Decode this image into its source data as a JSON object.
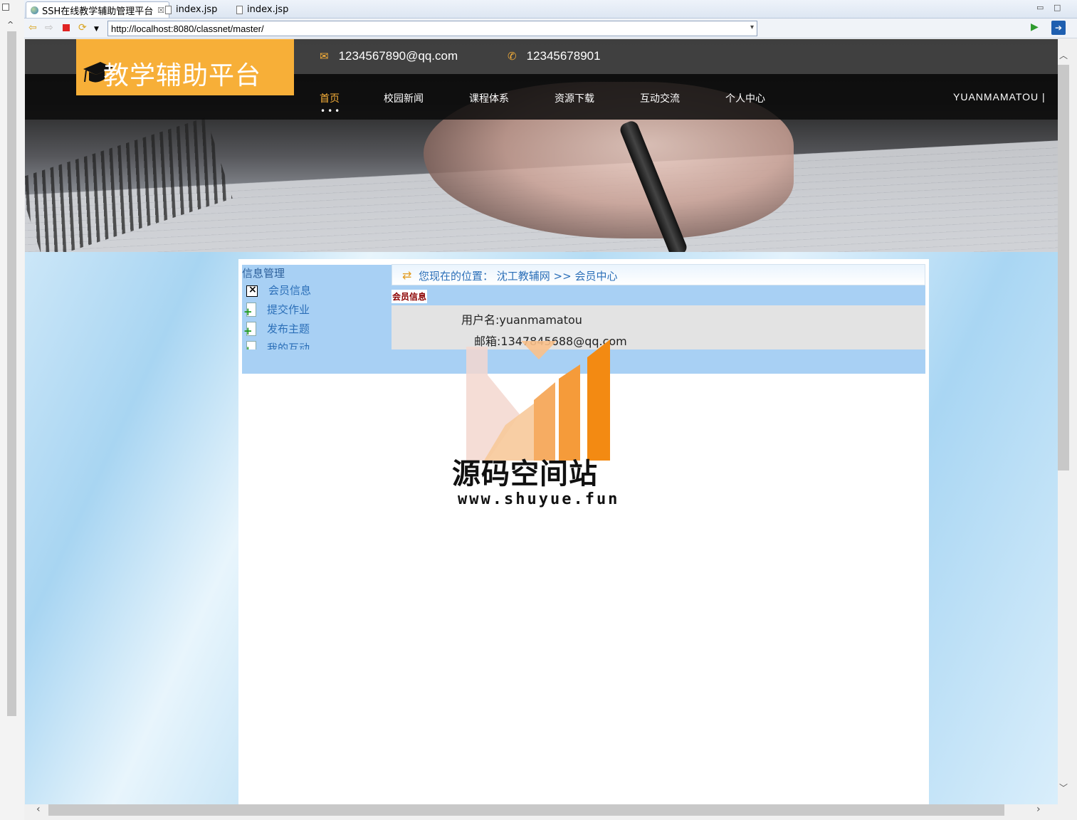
{
  "browser": {
    "tabs": [
      {
        "title": "SSH在线教学辅助管理平台",
        "close": "☒"
      },
      {
        "title": "index.jsp"
      },
      {
        "title": "index.jsp"
      }
    ],
    "url": "http://localhost:8080/classnet/master/"
  },
  "header": {
    "logo": "教学辅助平台",
    "email": "1234567890@qq.com",
    "phone": "12345678901",
    "menu": [
      "首页",
      "校园新闻",
      "课程体系",
      "资源下载",
      "互动交流",
      "个人中心"
    ],
    "active_menu": "首页",
    "user": "YUANMAMATOU |"
  },
  "sidebar": {
    "title": "信息管理",
    "items": [
      "会员信息",
      "提交作业",
      "发布主题",
      "我的互动"
    ]
  },
  "breadcrumb": "您现在的位置：  沈工教辅网 >> 会员中心",
  "info": {
    "tab": "会员信息",
    "username": "用户名:yuanmamatou",
    "email": "邮箱:1347845688@qq.com"
  },
  "watermark": {
    "name": "源码空间站",
    "url": "www.shuyue.fun"
  },
  "colors": {
    "accent": "#f7af38",
    "sidebar_bg": "#a8d0f4",
    "link": "#2b6fb8"
  }
}
